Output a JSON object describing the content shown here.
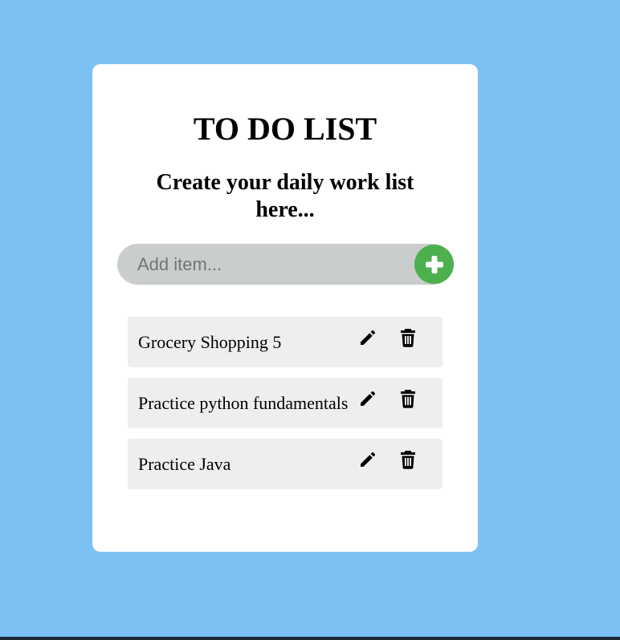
{
  "header": {
    "title": "TO DO LIST",
    "subtitle": "Create your daily work list here..."
  },
  "input": {
    "placeholder": "Add item...",
    "value": "",
    "add_icon": "plus-icon"
  },
  "items": [
    {
      "text": "Grocery Shopping 5",
      "edit_icon": "pencil-icon",
      "delete_icon": "trash-icon"
    },
    {
      "text": "Practice python fundamentals",
      "edit_icon": "pencil-icon",
      "delete_icon": "trash-icon"
    },
    {
      "text": "Practice Java",
      "edit_icon": "pencil-icon",
      "delete_icon": "trash-icon"
    }
  ],
  "colors": {
    "background": "#7bc1f3",
    "card": "#ffffff",
    "input_bg": "#cacdcd",
    "add_button": "#4cb04f",
    "item_bg": "#eceef0"
  }
}
